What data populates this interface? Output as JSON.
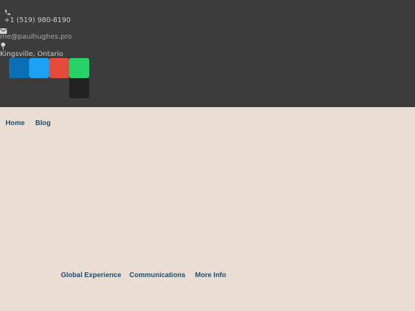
{
  "contact": {
    "phone": "+1 (519) 980-8190",
    "email": "me@paulhughes.pro",
    "location": "Kingsville, Ontario"
  },
  "social": [
    {
      "icon": "linkedin-icon",
      "color": "#0a6fb5"
    },
    {
      "icon": "twitter-icon",
      "color": "#1da1f2"
    },
    {
      "icon": "google-plus-icon",
      "color": "#e64a3b"
    },
    {
      "icon": "chat-icon",
      "color": "#25d366"
    },
    {
      "icon": "github-icon",
      "color": "#222222"
    }
  ],
  "nav": {
    "home": "Home",
    "blog": "Blog"
  },
  "section_nav": {
    "global_experience": "Global Experience",
    "communications": "Communications",
    "more_info": "More Info"
  },
  "colors": {
    "header_bg": "#3c3c3c",
    "page_bg": "#e9ddd4",
    "link": "#1d4f70"
  }
}
